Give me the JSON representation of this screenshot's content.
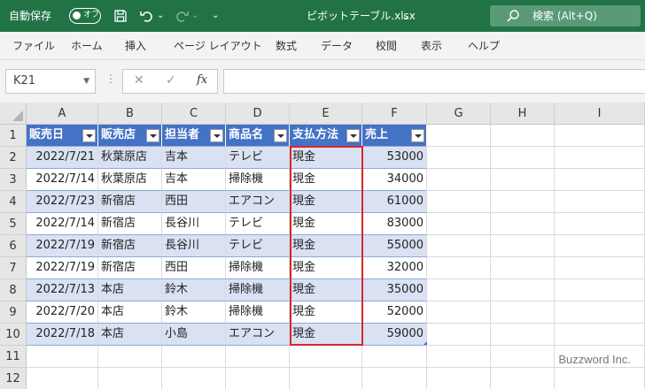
{
  "titlebar": {
    "autosave_label": "自動保存",
    "autosave_state": "オフ",
    "filename": "ピボットテーブル.xlsx",
    "filename_chevron": "⌄",
    "search_label": "検索 (Alt+Q)",
    "qat_more": "⌄",
    "accent_color": "#217346"
  },
  "menu": [
    "ファイル",
    "ホーム",
    "挿入",
    "ページ レイアウト",
    "数式",
    "データ",
    "校閲",
    "表示",
    "ヘルプ"
  ],
  "formula_bar": {
    "name_box": "K21",
    "separator": "⋮",
    "cancel": "✕",
    "enter": "✓",
    "fx": "fx",
    "content": ""
  },
  "columns": [
    "A",
    "B",
    "C",
    "D",
    "E",
    "F",
    "G",
    "H",
    "I"
  ],
  "rows": [
    "1",
    "2",
    "3",
    "4",
    "5",
    "6",
    "7",
    "8",
    "9",
    "10",
    "11",
    "12"
  ],
  "table": {
    "headers": [
      "販売日",
      "販売店",
      "担当者",
      "商品名",
      "支払方法",
      "売上"
    ],
    "rows": [
      [
        "2022/7/21",
        "秋葉原店",
        "吉本",
        "テレビ",
        "現金",
        "53000"
      ],
      [
        "2022/7/14",
        "秋葉原店",
        "吉本",
        "掃除機",
        "現金",
        "34000"
      ],
      [
        "2022/7/23",
        "新宿店",
        "西田",
        "エアコン",
        "現金",
        "61000"
      ],
      [
        "2022/7/14",
        "新宿店",
        "長谷川",
        "テレビ",
        "現金",
        "83000"
      ],
      [
        "2022/7/19",
        "新宿店",
        "長谷川",
        "テレビ",
        "現金",
        "55000"
      ],
      [
        "2022/7/19",
        "新宿店",
        "西田",
        "掃除機",
        "現金",
        "32000"
      ],
      [
        "2022/7/13",
        "本店",
        "鈴木",
        "掃除機",
        "現金",
        "35000"
      ],
      [
        "2022/7/20",
        "本店",
        "鈴木",
        "掃除機",
        "現金",
        "52000"
      ],
      [
        "2022/7/18",
        "本店",
        "小島",
        "エアコン",
        "現金",
        "59000"
      ]
    ],
    "header_color": "#4472c4",
    "band_color": "#d9e1f2",
    "highlight_color": "#d6262f"
  },
  "watermark": "Buzzword Inc."
}
